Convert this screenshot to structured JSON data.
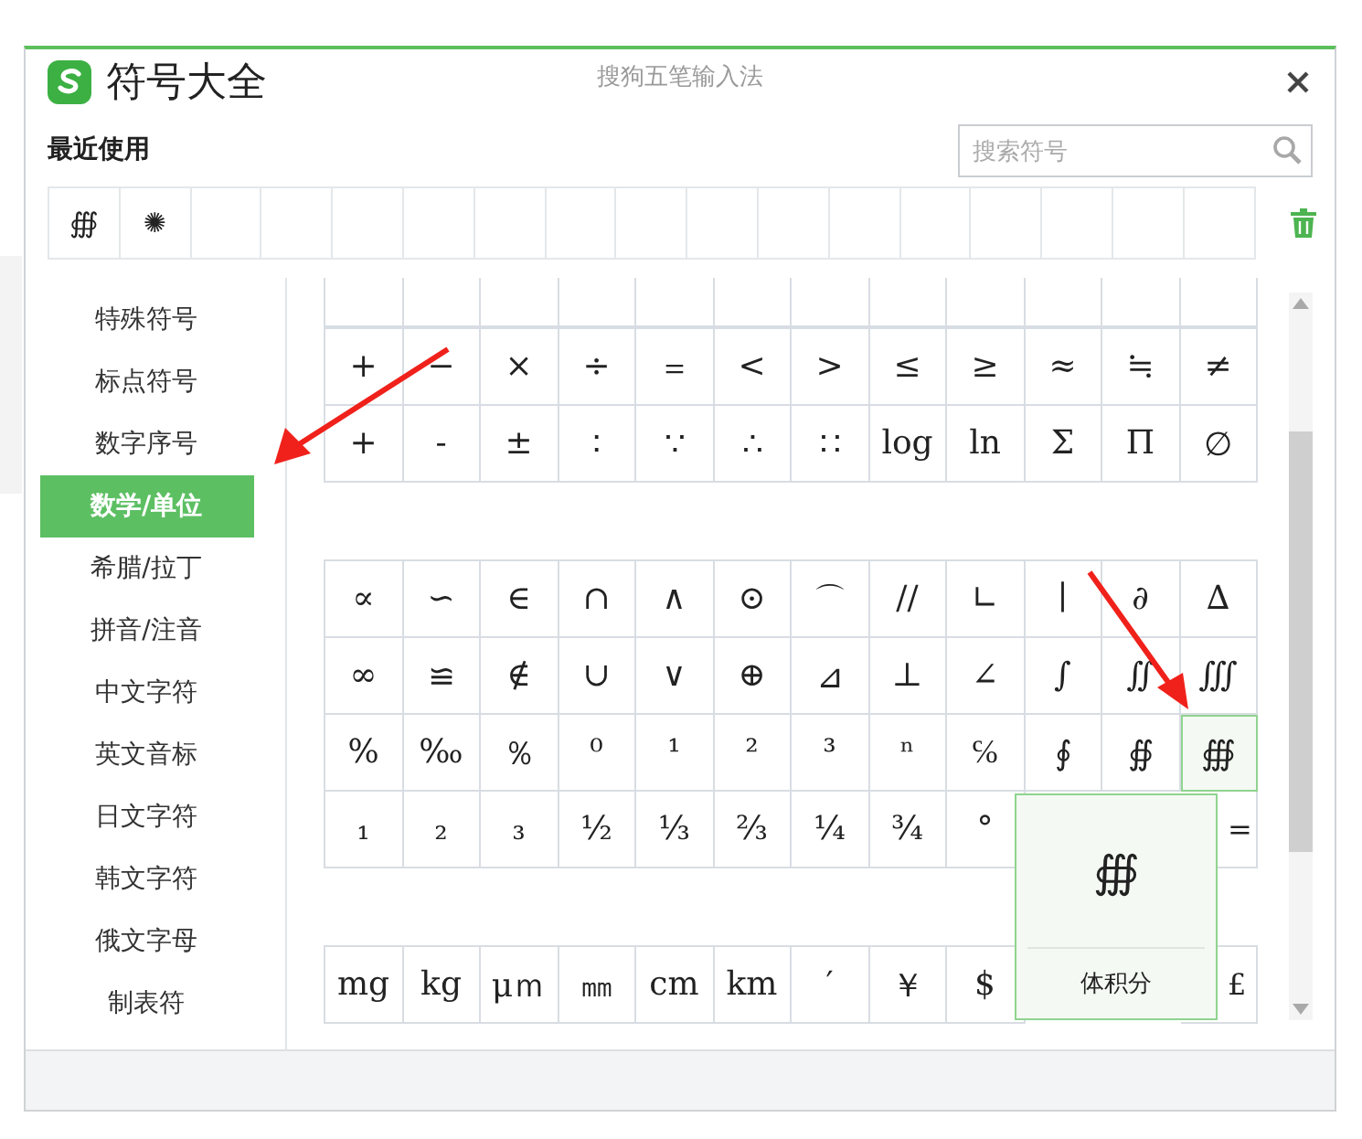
{
  "window": {
    "title": "符号大全",
    "subtitle": "搜狗五笔输入法"
  },
  "recent": {
    "label": "最近使用",
    "symbols": [
      "∰",
      "✺"
    ]
  },
  "search": {
    "placeholder": "搜索符号"
  },
  "categories": [
    {
      "label": "特殊符号",
      "selected": false
    },
    {
      "label": "标点符号",
      "selected": false
    },
    {
      "label": "数字序号",
      "selected": false
    },
    {
      "label": "数学/单位",
      "selected": true
    },
    {
      "label": "希腊/拉丁",
      "selected": false
    },
    {
      "label": "拼音/注音",
      "selected": false
    },
    {
      "label": "中文字符",
      "selected": false
    },
    {
      "label": "英文音标",
      "selected": false
    },
    {
      "label": "日文字符",
      "selected": false
    },
    {
      "label": "韩文字符",
      "selected": false
    },
    {
      "label": "俄文字母",
      "selected": false
    },
    {
      "label": "制表符",
      "selected": false
    }
  ],
  "blocks": [
    {
      "rows": [
        [
          {
            "symbol": "+",
            "selected": false
          },
          {
            "symbol": "−",
            "selected": false
          },
          {
            "symbol": "×",
            "selected": false
          },
          {
            "symbol": "÷",
            "selected": false
          },
          {
            "symbol": "＝",
            "selected": false
          },
          {
            "symbol": "<",
            "selected": false
          },
          {
            "symbol": ">",
            "selected": false
          },
          {
            "symbol": "≤",
            "selected": false
          },
          {
            "symbol": "≥",
            "selected": false
          },
          {
            "symbol": "≈",
            "selected": false
          },
          {
            "symbol": "≒",
            "selected": false
          },
          {
            "symbol": "≠",
            "selected": false
          }
        ],
        [
          {
            "symbol": "+",
            "selected": false
          },
          {
            "symbol": "-",
            "selected": false
          },
          {
            "symbol": "±",
            "selected": false
          },
          {
            "symbol": "∶",
            "selected": false
          },
          {
            "symbol": "∵",
            "selected": false
          },
          {
            "symbol": "∴",
            "selected": false
          },
          {
            "symbol": "∷",
            "selected": false
          },
          {
            "symbol": "log",
            "selected": false
          },
          {
            "symbol": "ln",
            "selected": false
          },
          {
            "symbol": "Σ",
            "selected": false
          },
          {
            "symbol": "Π",
            "selected": false
          },
          {
            "symbol": "∅",
            "selected": false
          }
        ]
      ]
    },
    {
      "rows": [
        [
          {
            "symbol": "∝",
            "selected": false
          },
          {
            "symbol": "∽",
            "selected": false
          },
          {
            "symbol": "∈",
            "selected": false
          },
          {
            "symbol": "∩",
            "selected": false
          },
          {
            "symbol": "∧",
            "selected": false
          },
          {
            "symbol": "⊙",
            "selected": false
          },
          {
            "symbol": "⌒",
            "selected": false
          },
          {
            "symbol": "//",
            "selected": false
          },
          {
            "symbol": "∟",
            "selected": false
          },
          {
            "symbol": "∣",
            "selected": false
          },
          {
            "symbol": "∂",
            "selected": false
          },
          {
            "symbol": "∆",
            "selected": false
          }
        ],
        [
          {
            "symbol": "∞",
            "selected": false
          },
          {
            "symbol": "≌",
            "selected": false
          },
          {
            "symbol": "∉",
            "selected": false
          },
          {
            "symbol": "∪",
            "selected": false
          },
          {
            "symbol": "∨",
            "selected": false
          },
          {
            "symbol": "⊕",
            "selected": false
          },
          {
            "symbol": "⊿",
            "selected": false
          },
          {
            "symbol": "⊥",
            "selected": false
          },
          {
            "symbol": "∠",
            "selected": false
          },
          {
            "symbol": "∫",
            "selected": false
          },
          {
            "symbol": "∬",
            "selected": false
          },
          {
            "symbol": "∭",
            "selected": false
          }
        ],
        [
          {
            "symbol": "%",
            "selected": false
          },
          {
            "symbol": "‰",
            "selected": false
          },
          {
            "symbol": "％",
            "selected": false
          },
          {
            "symbol": "⁰",
            "selected": false
          },
          {
            "symbol": "¹",
            "selected": false
          },
          {
            "symbol": "²",
            "selected": false
          },
          {
            "symbol": "³",
            "selected": false
          },
          {
            "symbol": "ⁿ",
            "selected": false
          },
          {
            "symbol": "℅",
            "selected": false
          },
          {
            "symbol": "∮",
            "selected": false
          },
          {
            "symbol": "∯",
            "selected": false
          },
          {
            "symbol": "∰",
            "selected": true
          }
        ],
        [
          {
            "symbol": "₁",
            "selected": false
          },
          {
            "symbol": "₂",
            "selected": false
          },
          {
            "symbol": "₃",
            "selected": false
          },
          {
            "symbol": "½",
            "selected": false
          },
          {
            "symbol": "⅓",
            "selected": false
          },
          {
            "symbol": "⅔",
            "selected": false
          },
          {
            "symbol": "¼",
            "selected": false
          },
          {
            "symbol": "¾",
            "selected": false
          },
          {
            "symbol": "°",
            "selected": false
          },
          null,
          null,
          {
            "symbol": "=",
            "selected": false
          }
        ]
      ]
    },
    {
      "rows": [
        [
          {
            "symbol": "mg",
            "selected": false
          },
          {
            "symbol": "kg",
            "selected": false
          },
          {
            "symbol": "μｍ",
            "selected": false
          },
          {
            "symbol": "㎜",
            "selected": false
          },
          {
            "symbol": "cm",
            "selected": false
          },
          {
            "symbol": "km",
            "selected": false
          },
          {
            "symbol": "′",
            "selected": false
          },
          {
            "symbol": "￥",
            "selected": false
          },
          {
            "symbol": "$",
            "selected": false
          },
          null,
          null,
          {
            "symbol": "£",
            "selected": false
          }
        ]
      ]
    }
  ],
  "preview": {
    "symbol": "∰",
    "name": "体积分"
  }
}
